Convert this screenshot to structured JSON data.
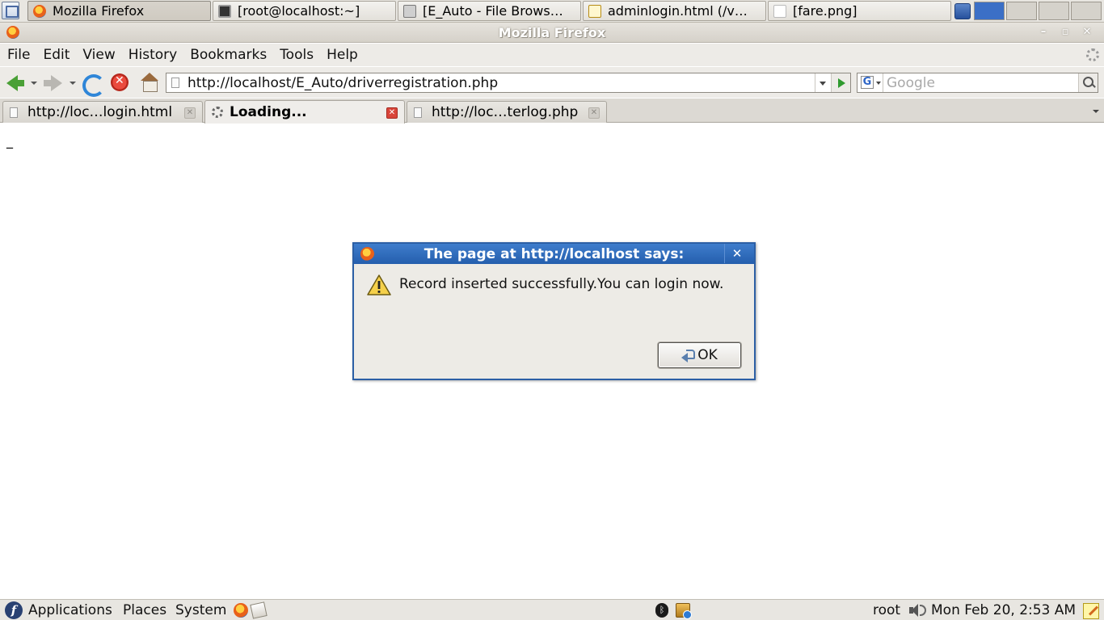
{
  "top_panel": {
    "tasks": [
      {
        "label": "Mozilla Firefox",
        "icon": "firefox-icon",
        "active": true
      },
      {
        "label": "[root@localhost:~]",
        "icon": "terminal-icon",
        "active": false
      },
      {
        "label": "[E_Auto - File Brows…",
        "icon": "folder-icon",
        "active": false
      },
      {
        "label": "adminlogin.html (/v…",
        "icon": "text-editor-icon",
        "active": false
      },
      {
        "label": "[fare.png]",
        "icon": "image-file-icon",
        "active": false
      }
    ]
  },
  "window": {
    "title": "Mozilla Firefox",
    "minimize": "–",
    "maximize": "▫",
    "close": "✕"
  },
  "menubar": {
    "items": [
      "File",
      "Edit",
      "View",
      "History",
      "Bookmarks",
      "Tools",
      "Help"
    ]
  },
  "navbar": {
    "url": "http://localhost/E_Auto/driverregistration.php",
    "search_engine": "G",
    "search_placeholder": "Google"
  },
  "tabs": [
    {
      "label": "http://loc…login.html",
      "selected": false,
      "loading": false
    },
    {
      "label": "Loading...",
      "selected": true,
      "loading": true
    },
    {
      "label": "http://loc…terlog.php",
      "selected": false,
      "loading": false
    }
  ],
  "content": {
    "cursor_text": "_"
  },
  "dialog": {
    "title": "The page at http://localhost says:",
    "message": "Record inserted successfully.You can login now.",
    "ok_label": "OK",
    "close_glyph": "✕"
  },
  "bottom_panel": {
    "menus": [
      "Applications",
      "Places",
      "System"
    ],
    "user": "root",
    "clock": "Mon Feb 20,  2:53 AM"
  },
  "colors": {
    "dialog_title_bar": "#2f6bbd",
    "panel_background": "#e8e6e1",
    "stop_button": "#e0453a"
  }
}
